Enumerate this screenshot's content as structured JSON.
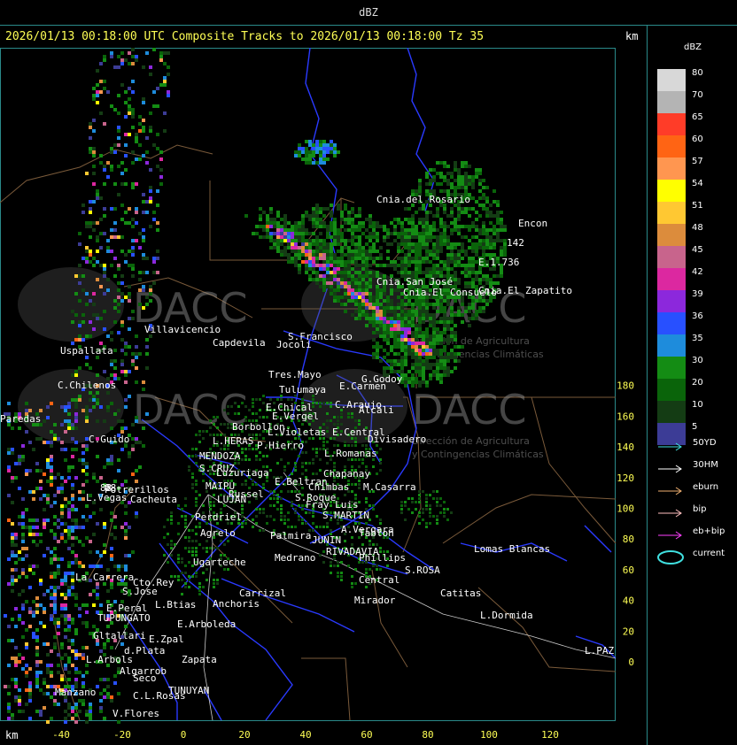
{
  "header": {
    "title": "dBZ",
    "subtitle": "2026/01/13 00:18:00 UTC Composite Tracks to 2026/01/13 00:18:00 Tz 35",
    "km_label_top": "km",
    "km_label_bottom": "km"
  },
  "axes": {
    "x_ticks": [
      "-40",
      "-20",
      "0",
      "20",
      "40",
      "60",
      "80",
      "100",
      "120"
    ],
    "y_ticks": [
      "180",
      "160",
      "140",
      "120",
      "100",
      "80",
      "60",
      "40",
      "20",
      "0"
    ]
  },
  "legend": {
    "title": "dBZ",
    "scale": [
      {
        "label": "80",
        "color": "#d8d8d8"
      },
      {
        "label": "70",
        "color": "#b4b4b4"
      },
      {
        "label": "65",
        "color": "#ff3c28"
      },
      {
        "label": "60",
        "color": "#ff6414"
      },
      {
        "label": "57",
        "color": "#ff9650"
      },
      {
        "label": "54",
        "color": "#ffff00"
      },
      {
        "label": "51",
        "color": "#ffc832"
      },
      {
        "label": "48",
        "color": "#dc8c3c"
      },
      {
        "label": "45",
        "color": "#c8648c"
      },
      {
        "label": "42",
        "color": "#dc28a0"
      },
      {
        "label": "39",
        "color": "#8c28dc"
      },
      {
        "label": "36",
        "color": "#2850ff"
      },
      {
        "label": "35",
        "color": "#1e8cdc"
      },
      {
        "label": "30",
        "color": "#148c14"
      },
      {
        "label": "20",
        "color": "#0a640a"
      },
      {
        "label": "10",
        "color": "#143c14"
      },
      {
        "label": "5",
        "color": "#3c3c96"
      }
    ],
    "tracks": [
      {
        "label": "50YD",
        "color": "#40e0e0"
      },
      {
        "label": "30HM",
        "color": "#ffffff"
      },
      {
        "label": "eburn",
        "color": "#f0b070"
      },
      {
        "label": "bip",
        "color": "#ffc0c0"
      },
      {
        "label": "eb+bip",
        "color": "#ff40ff"
      },
      {
        "label": "current",
        "color": "#40e0e0"
      }
    ]
  },
  "watermarks": [
    {
      "brand": "DACC",
      "line1": "Dirección de Agricultura",
      "line2": "y Contingencias Climáticas"
    },
    {
      "brand": "DACC",
      "line1": "Dirección de Agricultura",
      "line2": "y Contingencias Climáticas"
    }
  ],
  "places": [
    {
      "name": "Cnia.del Rosario"
    },
    {
      "name": "Encon"
    },
    {
      "name": "Cnia.San José"
    },
    {
      "name": "Cnia.El Consuelo"
    },
    {
      "name": "Cnia.El Zapatito"
    },
    {
      "name": "E.1.736"
    },
    {
      "name": "Uspallata"
    },
    {
      "name": "Villavicencio"
    },
    {
      "name": "Capdevila"
    },
    {
      "name": "S.Francisco"
    },
    {
      "name": "Jocoli"
    },
    {
      "name": "Tres.Mayo"
    },
    {
      "name": "Tulumaya"
    },
    {
      "name": "E.Carmen"
    },
    {
      "name": "G.Godoy"
    },
    {
      "name": "C.Chilenos"
    },
    {
      "name": "E.Chical"
    },
    {
      "name": "E.Vergel"
    },
    {
      "name": "C.Araujo"
    },
    {
      "name": "Alcali"
    },
    {
      "name": "Borbollon"
    },
    {
      "name": "L.Violetas"
    },
    {
      "name": "E.Central"
    },
    {
      "name": "Divisadero"
    },
    {
      "name": "C.Guido"
    },
    {
      "name": "L.HERAS"
    },
    {
      "name": "P.Hierro"
    },
    {
      "name": "L.Romanas"
    },
    {
      "name": "MENDOZA"
    },
    {
      "name": "S.CRUZ"
    },
    {
      "name": "Luzuriaga"
    },
    {
      "name": "E.Beltran"
    },
    {
      "name": "Chapanay"
    },
    {
      "name": "Potrerillos"
    },
    {
      "name": "Cacheuta"
    },
    {
      "name": "MAIPU"
    },
    {
      "name": "Chimbas"
    },
    {
      "name": "M.Casarra"
    },
    {
      "name": "L.Vegas"
    },
    {
      "name": "LUJAN"
    },
    {
      "name": "Russel"
    },
    {
      "name": "S.Roque"
    },
    {
      "name": "Fray Luis"
    },
    {
      "name": "Perdriel"
    },
    {
      "name": "S.MARTIN"
    },
    {
      "name": "Agrelo"
    },
    {
      "name": "Palmira"
    },
    {
      "name": "A.Vergara"
    },
    {
      "name": "Tablon"
    },
    {
      "name": "JUNIN"
    },
    {
      "name": "Ugarteche"
    },
    {
      "name": "RIVADAVIA"
    },
    {
      "name": "Phillips"
    },
    {
      "name": "S.ROSA"
    },
    {
      "name": "Lomas Blancas"
    },
    {
      "name": "La Carrera"
    },
    {
      "name": "Cto.Rey"
    },
    {
      "name": "S.Jose"
    },
    {
      "name": "Carrizal"
    },
    {
      "name": "Medrano"
    },
    {
      "name": "Central"
    },
    {
      "name": "Catitas"
    },
    {
      "name": "Anchoris"
    },
    {
      "name": "E.Peral"
    },
    {
      "name": "TUPUNGATO"
    },
    {
      "name": "L.Btias"
    },
    {
      "name": "Mirador"
    },
    {
      "name": "L.Dormida"
    },
    {
      "name": "E.Arboleda"
    },
    {
      "name": "Gltallari"
    },
    {
      "name": "E.Zpal"
    },
    {
      "name": "L.Arbols"
    },
    {
      "name": "d.Plata"
    },
    {
      "name": "Zapata"
    },
    {
      "name": "L.PAZ"
    },
    {
      "name": "Algarrob"
    },
    {
      "name": "Manzano"
    },
    {
      "name": "Seco"
    },
    {
      "name": "TUNUYAN"
    },
    {
      "name": "C.L.Rosas"
    },
    {
      "name": "V.Flores"
    },
    {
      "name": "Paredas"
    },
    {
      "name": "142"
    },
    {
      "name": "98"
    },
    {
      "name": "88"
    }
  ]
}
